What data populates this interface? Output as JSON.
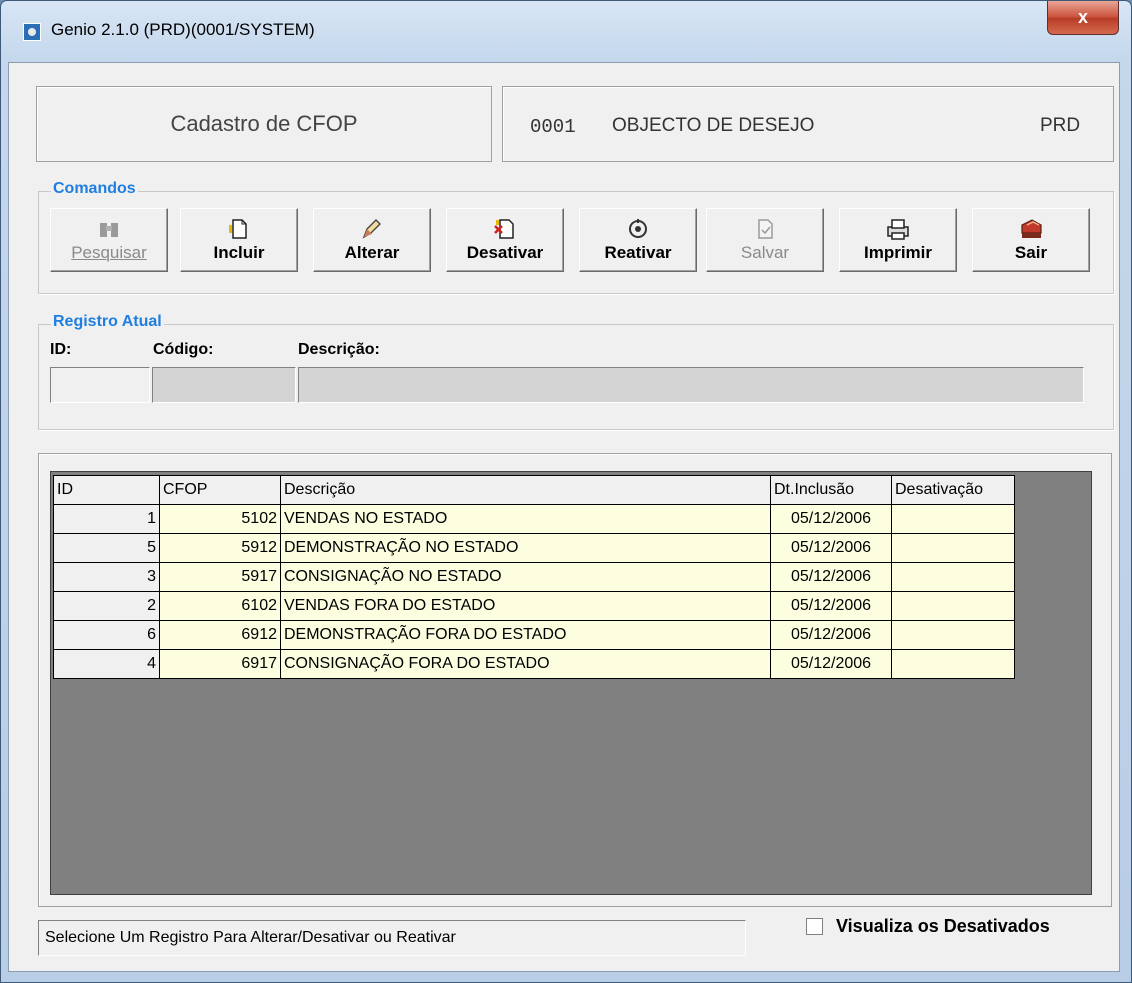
{
  "window": {
    "title": "Genio 2.1.0 (PRD)(0001/SYSTEM)",
    "close_label": "x"
  },
  "header": {
    "form_title": "Cadastro de CFOP",
    "company_code": "0001",
    "company_name": "OBJECTO DE DESEJO",
    "env": "PRD"
  },
  "comandos": {
    "label": "Comandos",
    "buttons": [
      {
        "label": "Pesquisar",
        "icon": "binoculars-icon",
        "enabled": false
      },
      {
        "label": "Incluir",
        "icon": "new-document-icon",
        "enabled": true
      },
      {
        "label": "Alterar",
        "icon": "pencil-icon",
        "enabled": true
      },
      {
        "label": "Desativar",
        "icon": "delete-document-icon",
        "enabled": true
      },
      {
        "label": "Reativar",
        "icon": "reactivate-icon",
        "enabled": true
      },
      {
        "label": "Salvar",
        "icon": "save-icon",
        "enabled": false
      },
      {
        "label": "Imprimir",
        "icon": "printer-icon",
        "enabled": true
      },
      {
        "label": "Sair",
        "icon": "exit-icon",
        "enabled": true
      }
    ]
  },
  "registro": {
    "label": "Registro Atual",
    "id_label": "ID:",
    "codigo_label": "Código:",
    "descricao_label": "Descrição:",
    "id_value": "",
    "codigo_value": "",
    "descricao_value": ""
  },
  "grid": {
    "headers": [
      "ID",
      "CFOP",
      "Descrição",
      "Dt.Inclusão",
      "Desativação"
    ],
    "rows": [
      {
        "id": "1",
        "cfop": "5102",
        "descricao": "VENDAS NO ESTADO",
        "dt_inclusao": "05/12/2006",
        "desativacao": ""
      },
      {
        "id": "5",
        "cfop": "5912",
        "descricao": "DEMONSTRAÇÃO NO ESTADO",
        "dt_inclusao": "05/12/2006",
        "desativacao": ""
      },
      {
        "id": "3",
        "cfop": "5917",
        "descricao": "CONSIGNAÇÃO NO ESTADO",
        "dt_inclusao": "05/12/2006",
        "desativacao": ""
      },
      {
        "id": "2",
        "cfop": "6102",
        "descricao": "VENDAS FORA DO ESTADO",
        "dt_inclusao": "05/12/2006",
        "desativacao": ""
      },
      {
        "id": "6",
        "cfop": "6912",
        "descricao": "DEMONSTRAÇÃO FORA DO ESTADO",
        "dt_inclusao": "05/12/2006",
        "desativacao": ""
      },
      {
        "id": "4",
        "cfop": "6917",
        "descricao": "CONSIGNAÇÃO FORA DO ESTADO",
        "dt_inclusao": "05/12/2006",
        "desativacao": ""
      }
    ]
  },
  "status": {
    "text": "Selecione Um Registro Para Alterar/Desativar ou Reativar"
  },
  "show_inactive": {
    "label": "Visualiza os Desativados",
    "checked": false
  },
  "colors": {
    "group_label": "#1f7fe0",
    "grid_bg": "#808080",
    "cell_bg": "#fdfde0"
  }
}
